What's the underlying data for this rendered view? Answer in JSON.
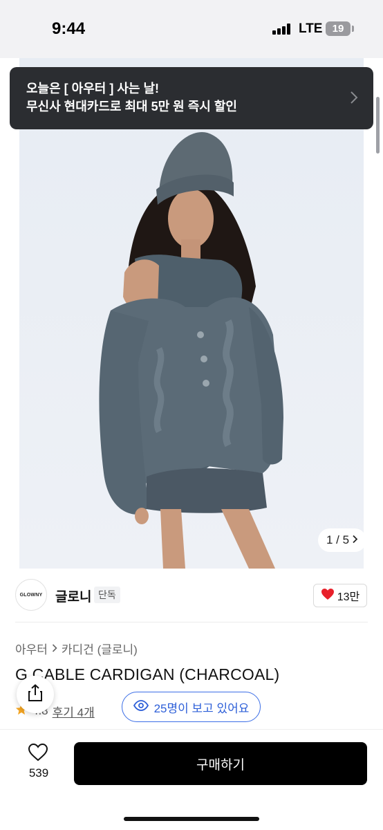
{
  "status_bar": {
    "time": "9:44",
    "network": "LTE",
    "battery": "19"
  },
  "promo_banner": {
    "line1": "오늘은 [ 아우터 ] 사는 날!",
    "line2": "무신사 현대카드로 최대 5만 원 즉시 할인"
  },
  "gallery": {
    "counter": "1 / 5"
  },
  "brand": {
    "logo_text": "GLOWNY",
    "name": "글로니",
    "badge": "단독",
    "like_count": "13만"
  },
  "product": {
    "breadcrumb": [
      "아우터",
      "카디건 (글로니)"
    ],
    "title": "G CABLE CARDIGAN (CHARCOAL)",
    "rating": "4.8",
    "review_label": "후기 4개",
    "viewers_label": "25명이 보고 있어요"
  },
  "bottom_bar": {
    "wish_count": "539",
    "buy_label": "구매하기"
  },
  "colors": {
    "accent_blue": "#2d5fd8",
    "heart_red": "#e8202a",
    "banner_bg": "#2b2d31",
    "buy_bg": "#000000"
  }
}
